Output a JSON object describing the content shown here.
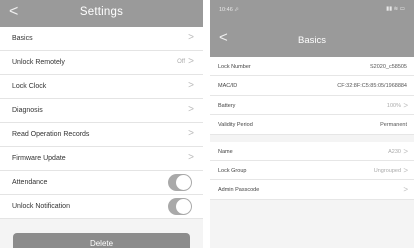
{
  "settings": {
    "title": "Settings",
    "back_icon": "chevron-left-icon",
    "rows": [
      {
        "label": "Basics",
        "value": ""
      },
      {
        "label": "Unlock Remotely",
        "value": "Off"
      },
      {
        "label": "Lock Clock",
        "value": ""
      },
      {
        "label": "Diagnosis",
        "value": ""
      },
      {
        "label": "Read Operation Records",
        "value": ""
      },
      {
        "label": "Firmware Update",
        "value": ""
      },
      {
        "label": "Attendance",
        "toggle": true
      },
      {
        "label": "Unlock Notification",
        "toggle": true
      }
    ],
    "delete_label": "Delete"
  },
  "basics": {
    "status_time": "10:46 ⬀",
    "status_icons": "▮▮ ≋ ▭",
    "title": "Basics",
    "rows_a": [
      {
        "label": "Lock Number",
        "value": "S2020_c58505"
      },
      {
        "label": "MAC/ID",
        "value": "CF:32:8F:C5:85:05/1968884"
      },
      {
        "label": "Battery",
        "value": "100%"
      },
      {
        "label": "Validity Period",
        "value": "Permanent"
      }
    ],
    "rows_b": [
      {
        "label": "Name",
        "value": "A230"
      },
      {
        "label": "Lock Group",
        "value": "Ungrouped"
      },
      {
        "label": "Admin Passcode",
        "value": ""
      }
    ]
  },
  "colors": {
    "nav_bar": "#9a9a9a",
    "toggle_on": "#a9a9a9",
    "delete_button": "#8c8c8c",
    "background": "#f4f4f4"
  }
}
